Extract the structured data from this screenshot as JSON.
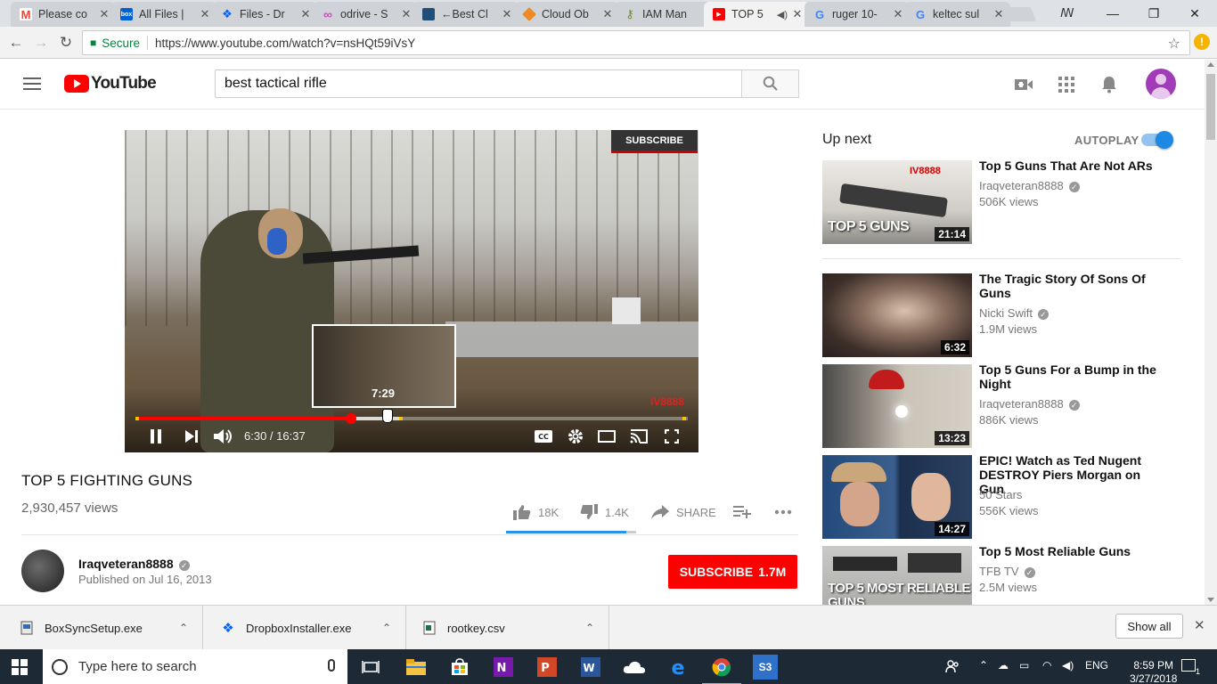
{
  "browser": {
    "tabs": [
      {
        "title": "Please co",
        "favicon": "gmail-icon",
        "color": "#ea4335",
        "active": false
      },
      {
        "title": "All Files |",
        "favicon": "box-icon",
        "color": "#0061d5",
        "active": false
      },
      {
        "title": "Files - Dr",
        "favicon": "dropbox-icon",
        "color": "#0061fe",
        "active": false
      },
      {
        "title": "odrive - S",
        "favicon": "odrive-icon",
        "color": "#d147c4",
        "active": false
      },
      {
        "title": "←Best Cl",
        "favicon": "cloud-storage-icon",
        "color": "#1f4e79",
        "active": false
      },
      {
        "title": "Cloud Ob",
        "favicon": "aws-cube-icon",
        "color": "#f08a24",
        "active": false
      },
      {
        "title": "IAM Man",
        "favicon": "aws-iam-icon",
        "color": "#6b8e23",
        "active": false
      },
      {
        "title": "TOP 5",
        "favicon": "youtube-icon",
        "color": "#ff0000",
        "active": true,
        "audio": true
      },
      {
        "title": "ruger 10-",
        "favicon": "google-icon",
        "color": "#4285f4",
        "active": false
      },
      {
        "title": "keltec sul",
        "favicon": "google-icon",
        "color": "#4285f4",
        "active": false
      }
    ],
    "secure_label": "Secure",
    "url": "https://www.youtube.com/watch?v=nsHQt59iVsY"
  },
  "youtube": {
    "logo_text": "YouTube",
    "search_value": "best tactical rifle",
    "video": {
      "overlay_subscribe": "SUBSCRIBE",
      "watermark": "IV8888",
      "preview_time": "7:29",
      "current_time": "6:30",
      "duration": "16:37",
      "time_display": "6:30 / 16:37",
      "progress_played": 0.391,
      "progress_buffered": 0.481,
      "hover_position": 0.45
    },
    "title": "TOP 5 FIGHTING GUNS",
    "views": "2,930,457 views",
    "likes": "18K",
    "dislikes": "1.4K",
    "share_label": "SHARE",
    "like_ratio": 0.928,
    "channel": {
      "name": "Iraqveteran8888",
      "published": "Published on Jul 16, 2013"
    },
    "subscribe": {
      "label": "SUBSCRIBE",
      "count": "1.7M"
    },
    "upnext": {
      "heading": "Up next",
      "autoplay_label": "AUTOPLAY",
      "autoplay_on": true
    },
    "recommendations": [
      {
        "title": "Top 5 Guns That Are Not ARs",
        "channel": "Iraqveteran8888",
        "views": "506K views",
        "duration": "21:14",
        "thumb_text": "TOP 5 GUNS",
        "thumb_badge": "IV8888"
      },
      {
        "title": "The Tragic Story Of Sons Of Guns",
        "channel": "Nicki Swift",
        "views": "1.9M views",
        "duration": "6:32",
        "thumb_text": ""
      },
      {
        "title": "Top 5 Guns For a Bump in the Night",
        "channel": "Iraqveteran8888",
        "views": "886K views",
        "duration": "13:23",
        "thumb_text": ""
      },
      {
        "title": "EPIC! Watch as Ted Nugent DESTROY Piers Morgan on Gun",
        "channel": "50 Stars",
        "views": "556K views",
        "duration": "14:27",
        "thumb_text": ""
      },
      {
        "title": "Top 5 Most Reliable Guns",
        "channel": "TFB TV",
        "views": "2.5M views",
        "duration": "",
        "thumb_text": "TOP 5 MOST RELIABLE GUNS"
      }
    ]
  },
  "downloads": {
    "items": [
      {
        "name": "BoxSyncSetup.exe"
      },
      {
        "name": "DropboxInstaller.exe"
      },
      {
        "name": "rootkey.csv"
      }
    ],
    "show_all": "Show all"
  },
  "taskbar": {
    "search_placeholder": "Type here to search",
    "language": "ENG",
    "time": "8:59 PM",
    "date": "3/27/2018",
    "notification_count": "1"
  }
}
